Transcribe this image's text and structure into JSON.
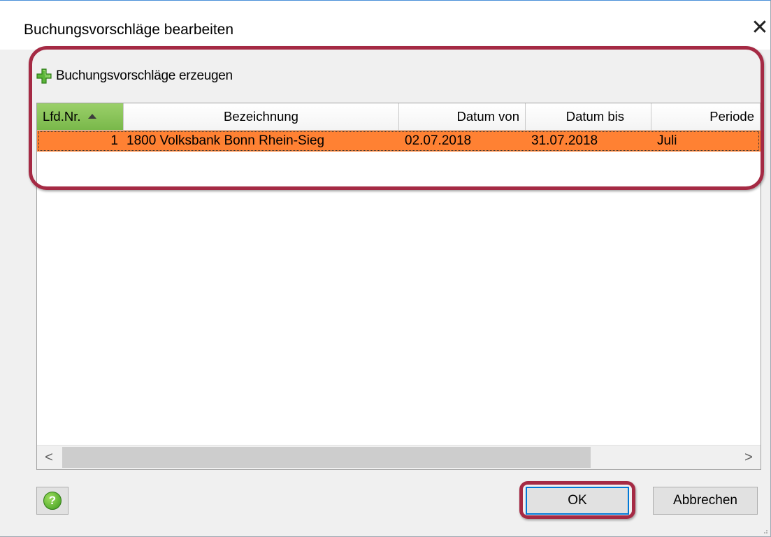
{
  "window": {
    "title": "Buchungsvorschläge bearbeiten",
    "close_glyph": "✕"
  },
  "toolbar": {
    "create_label": "Buchungsvorschläge erzeugen",
    "create_icon": "plus-icon",
    "accent": "#5bb539"
  },
  "grid": {
    "columns": [
      {
        "label": "Lfd.Nr.",
        "sorted": true
      },
      {
        "label": "Bezeichnung"
      },
      {
        "label": "Datum von"
      },
      {
        "label": "Datum bis"
      },
      {
        "label": "Periode"
      }
    ],
    "rows": [
      {
        "nr": "1",
        "bezeichnung": "1800 Volksbank Bonn Rhein-Sieg",
        "datum_von": "02.07.2018",
        "datum_bis": "31.07.2018",
        "periode": "Juli"
      }
    ],
    "selected_row_color": "#ff8133",
    "scroll_left": "<",
    "scroll_right": ">"
  },
  "footer": {
    "help_icon": "help-icon",
    "ok_label": "OK",
    "cancel_label": "Abbrechen"
  },
  "highlight_color": "#a52a44"
}
